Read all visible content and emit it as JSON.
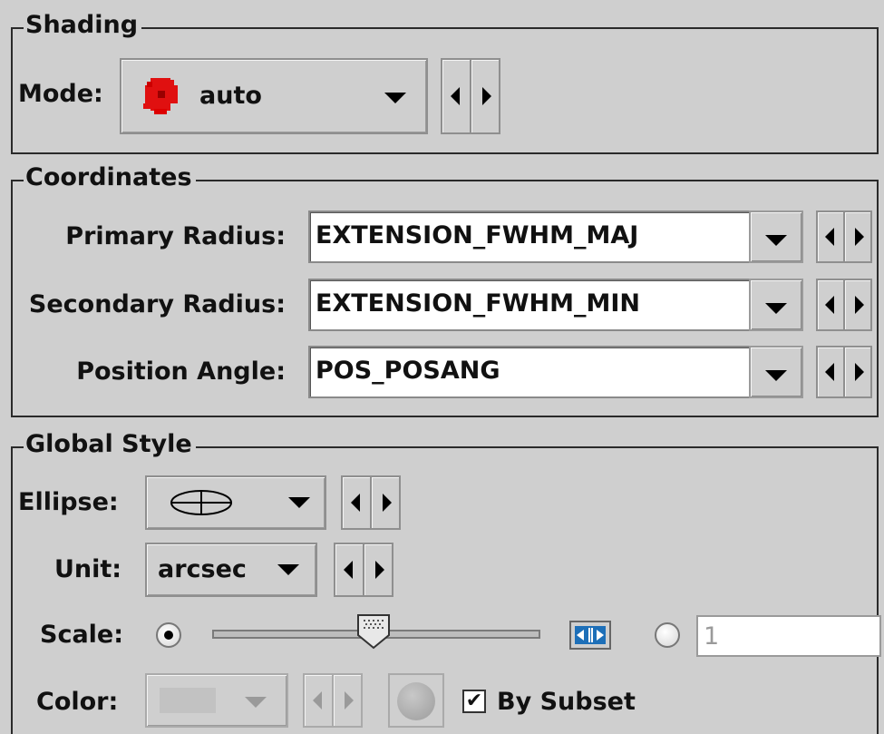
{
  "shading": {
    "title": "Shading",
    "mode_label": "Mode:",
    "mode_value": "auto",
    "mode_icon": "red-blob-icon"
  },
  "coordinates": {
    "title": "Coordinates",
    "primary_label": "Primary Radius:",
    "primary_value": "EXTENSION_FWHM_MAJ",
    "secondary_label": "Secondary Radius:",
    "secondary_value": "EXTENSION_FWHM_MIN",
    "angle_label": "Position Angle:",
    "angle_value": "POS_POSANG"
  },
  "global_style": {
    "title": "Global Style",
    "ellipse_label": "Ellipse:",
    "ellipse_icon": "ellipse-cross-icon",
    "unit_label": "Unit:",
    "unit_value": "arcsec",
    "scale_label": "Scale:",
    "scale_slider_fraction": 0.49,
    "scale_auto_icon": "fit-arrows-icon",
    "scale_text_value": "1",
    "color_label": "Color:",
    "by_subset_label": "By Subset",
    "by_subset_checked": true
  },
  "colors": {
    "background": "#cfcfcf",
    "blob": "#e01010",
    "disabled": "#9a9a9a"
  }
}
